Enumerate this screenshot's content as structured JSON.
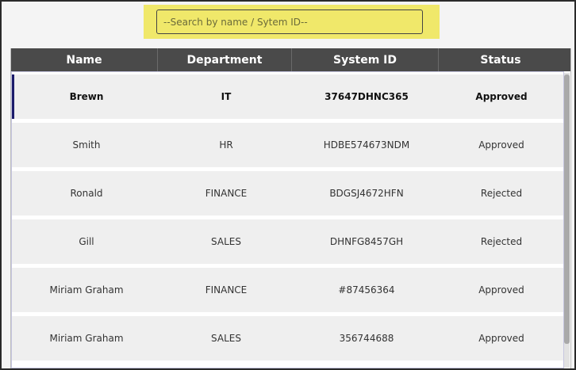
{
  "search": {
    "placeholder": "--Search by name / Sytem ID--",
    "value": ""
  },
  "table": {
    "columns": [
      "Name",
      "Department",
      "System ID",
      "Status"
    ],
    "rows": [
      {
        "name": "Brewn",
        "department": "IT",
        "system_id": "37647DHNC365",
        "status": "Approved",
        "selected": true
      },
      {
        "name": "Smith",
        "department": "HR",
        "system_id": "HDBE574673NDM",
        "status": "Approved"
      },
      {
        "name": "Ronald",
        "department": "FINANCE",
        "system_id": "BDGSJ4672HFN",
        "status": "Rejected"
      },
      {
        "name": "Gill",
        "department": "SALES",
        "system_id": "DHNFG8457GH",
        "status": "Rejected"
      },
      {
        "name": "Miriam Graham",
        "department": "FINANCE",
        "system_id": "#87456364",
        "status": "Approved"
      },
      {
        "name": "Miriam Graham",
        "department": "SALES",
        "system_id": "356744688",
        "status": "Approved"
      }
    ]
  },
  "colors": {
    "header_bg": "#4a4a4a",
    "search_highlight": "#f0e86a",
    "row_bg": "#efefef",
    "selected_indicator": "#1c1c6b"
  }
}
